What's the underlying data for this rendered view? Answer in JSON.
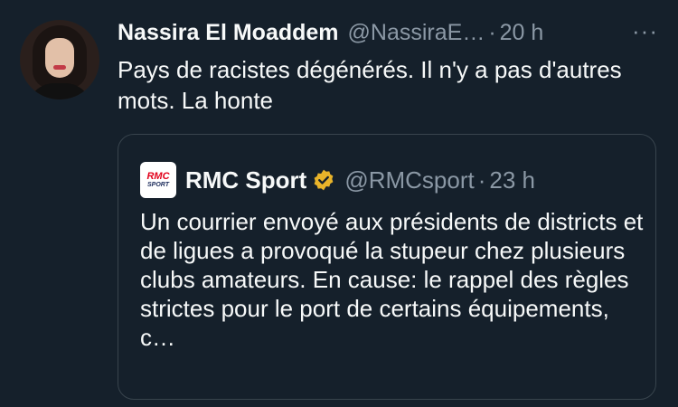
{
  "tweet": {
    "author_name": "Nassira El Moaddem",
    "author_handle": "@NassiraE…",
    "separator": "·",
    "time": "20 h",
    "more_label": "···",
    "text": "Pays de racistes dégénérés. Il n'y a pas d'autres mots. La honte"
  },
  "quoted": {
    "logo_line1": "RMC",
    "logo_line2": "SPORT",
    "author_name": "RMC Sport",
    "author_handle": "@RMCsport",
    "separator": "·",
    "time": "23 h",
    "text": "Un courrier envoyé aux présidents de districts et de ligues a provoqué la stupeur chez plusieurs clubs amateurs. En cause: le rappel des règles strictes pour le port de certains équipements, c…"
  },
  "colors": {
    "background": "#15202b",
    "text_primary": "#f7f9f9",
    "text_secondary": "#8b98a5",
    "border": "#38444d",
    "verified_badge": "#e8b32a"
  }
}
